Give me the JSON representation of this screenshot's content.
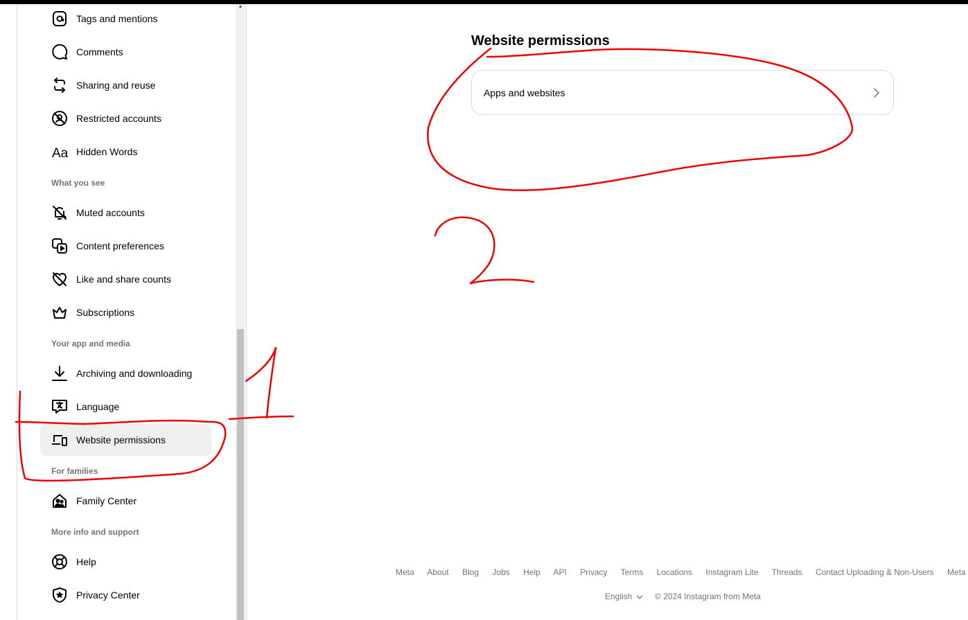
{
  "sidebar": {
    "items": [
      {
        "label": "Tags and mentions",
        "icon": "at-sign-icon"
      },
      {
        "label": "Comments",
        "icon": "comment-icon"
      },
      {
        "label": "Sharing and reuse",
        "icon": "share-reuse-icon"
      },
      {
        "label": "Restricted accounts",
        "icon": "restricted-icon"
      },
      {
        "label": "Hidden Words",
        "icon": "text-aa-icon"
      },
      {
        "label": "Muted accounts",
        "icon": "muted-bell-icon"
      },
      {
        "label": "Content preferences",
        "icon": "content-preferences-icon"
      },
      {
        "label": "Like and share counts",
        "icon": "heart-off-icon"
      },
      {
        "label": "Subscriptions",
        "icon": "crown-icon"
      },
      {
        "label": "Archiving and downloading",
        "icon": "download-icon"
      },
      {
        "label": "Language",
        "icon": "translate-icon"
      },
      {
        "label": "Website permissions",
        "icon": "devices-icon",
        "active": true
      },
      {
        "label": "Family Center",
        "icon": "family-home-icon"
      },
      {
        "label": "Help",
        "icon": "lifebuoy-icon"
      },
      {
        "label": "Privacy Center",
        "icon": "shield-star-icon"
      }
    ],
    "sections": {
      "what_you_see": "What you see",
      "your_app_and_media": "Your app and media",
      "for_families": "For families",
      "more_info": "More info and support"
    }
  },
  "main": {
    "title": "Website permissions",
    "card_label": "Apps and websites"
  },
  "footer": {
    "links": [
      "Meta",
      "About",
      "Blog",
      "Jobs",
      "Help",
      "API",
      "Privacy",
      "Terms",
      "Locations",
      "Instagram Lite",
      "Threads",
      "Contact Uploading & Non-Users",
      "Meta Verified"
    ],
    "language": "English",
    "copyright": "© 2024 Instagram from Meta"
  },
  "annotations": {
    "number_one": "1",
    "number_two": "2",
    "color": "#ee0000"
  }
}
